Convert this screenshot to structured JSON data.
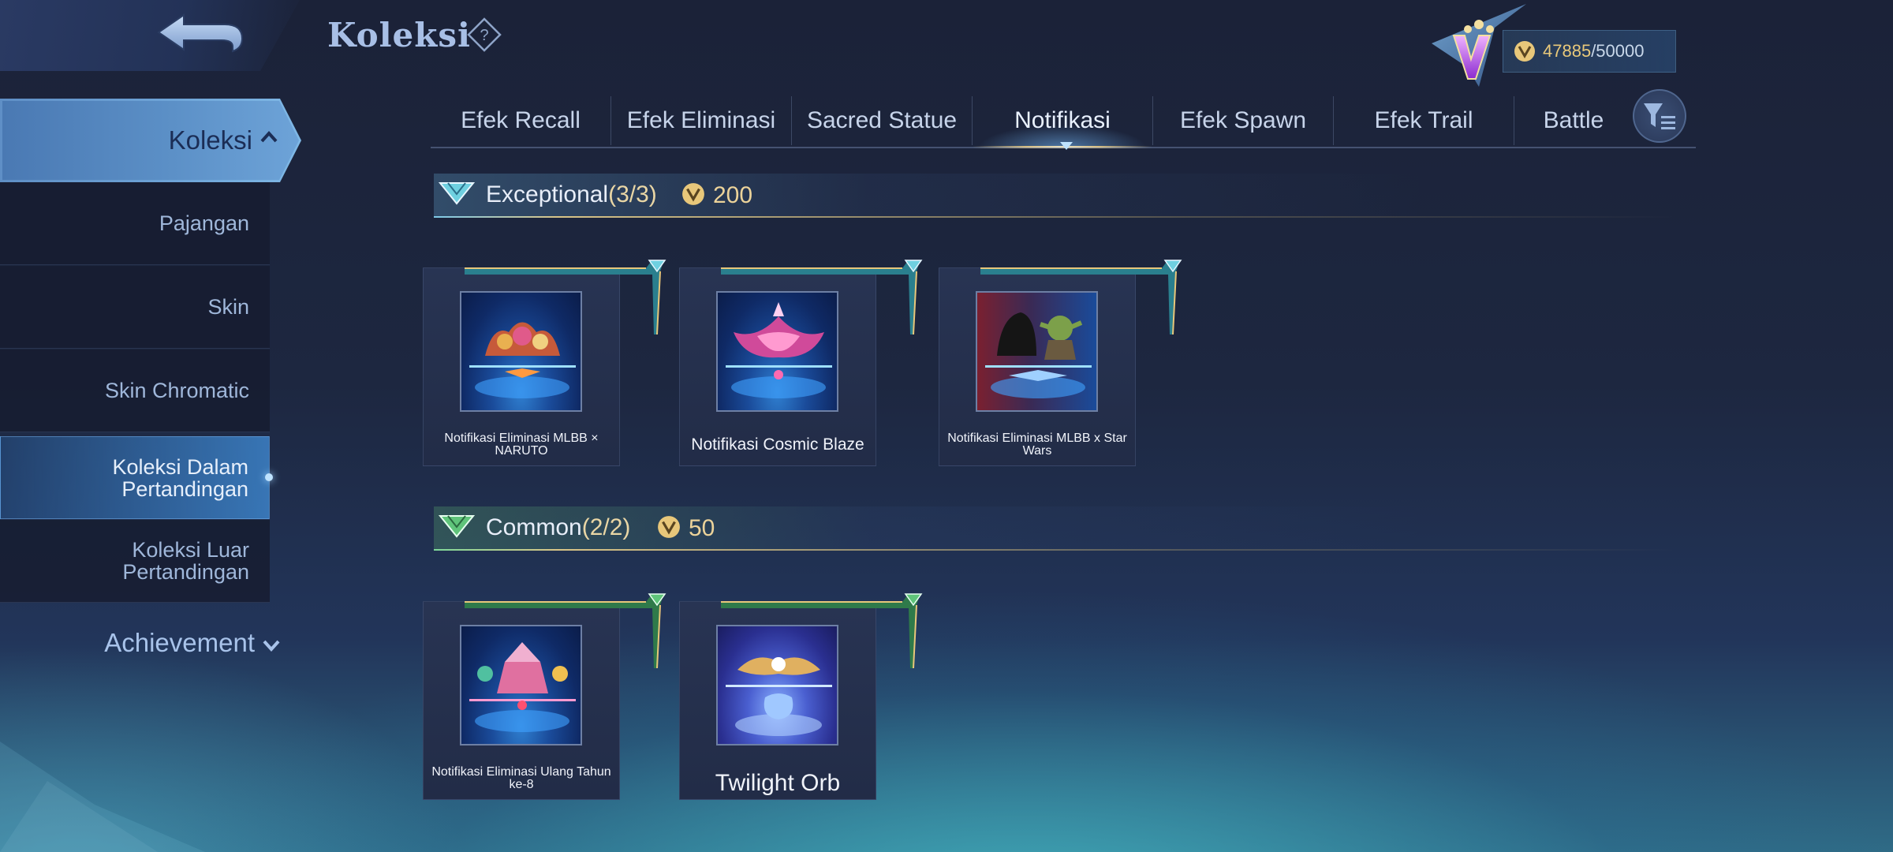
{
  "header": {
    "title": "Koleksi",
    "currency_current": "47885",
    "currency_max": "/50000"
  },
  "sidebar": {
    "active_section": "Koleksi",
    "items": [
      {
        "label": "Pajangan",
        "selected": false
      },
      {
        "label": "Skin",
        "selected": false
      },
      {
        "label": "Skin Chromatic",
        "selected": false
      },
      {
        "label": "Koleksi Dalam Pertandingan",
        "selected": true
      },
      {
        "label": "Koleksi Luar Pertandingan",
        "selected": false
      }
    ],
    "achievement": "Achievement"
  },
  "tabs": [
    {
      "label": "Efek Recall",
      "active": false
    },
    {
      "label": "Efek Eliminasi",
      "active": false
    },
    {
      "label": "Sacred Statue",
      "active": false
    },
    {
      "label": "Notifikasi",
      "active": true
    },
    {
      "label": "Efek Spawn",
      "active": false
    },
    {
      "label": "Efek Trail",
      "active": false
    },
    {
      "label": "Battle",
      "active": false
    }
  ],
  "sections": [
    {
      "name": "Exceptional",
      "count": "(3/3)",
      "points": "200",
      "items": [
        {
          "name": "Notifikasi Eliminasi MLBB × NARUTO",
          "theme": "naruto"
        },
        {
          "name": "Notifikasi Cosmic Blaze",
          "theme": "cosmic"
        },
        {
          "name": "Notifikasi Eliminasi MLBB x Star Wars",
          "theme": "starwars"
        }
      ]
    },
    {
      "name": "Common",
      "count": "(2/2)",
      "points": "50",
      "items": [
        {
          "name": "Notifikasi Eliminasi Ulang Tahun ke-8",
          "theme": "anniversary"
        },
        {
          "name": "Twilight Orb",
          "theme": "twilight"
        }
      ]
    }
  ],
  "colors": {
    "background": "#1d2740",
    "accent_gold": "#e8c77a",
    "accent_blue": "#6fa5d8",
    "exceptional_ribbon": "#2a7f8e",
    "common_ribbon": "#2f7a4a"
  }
}
